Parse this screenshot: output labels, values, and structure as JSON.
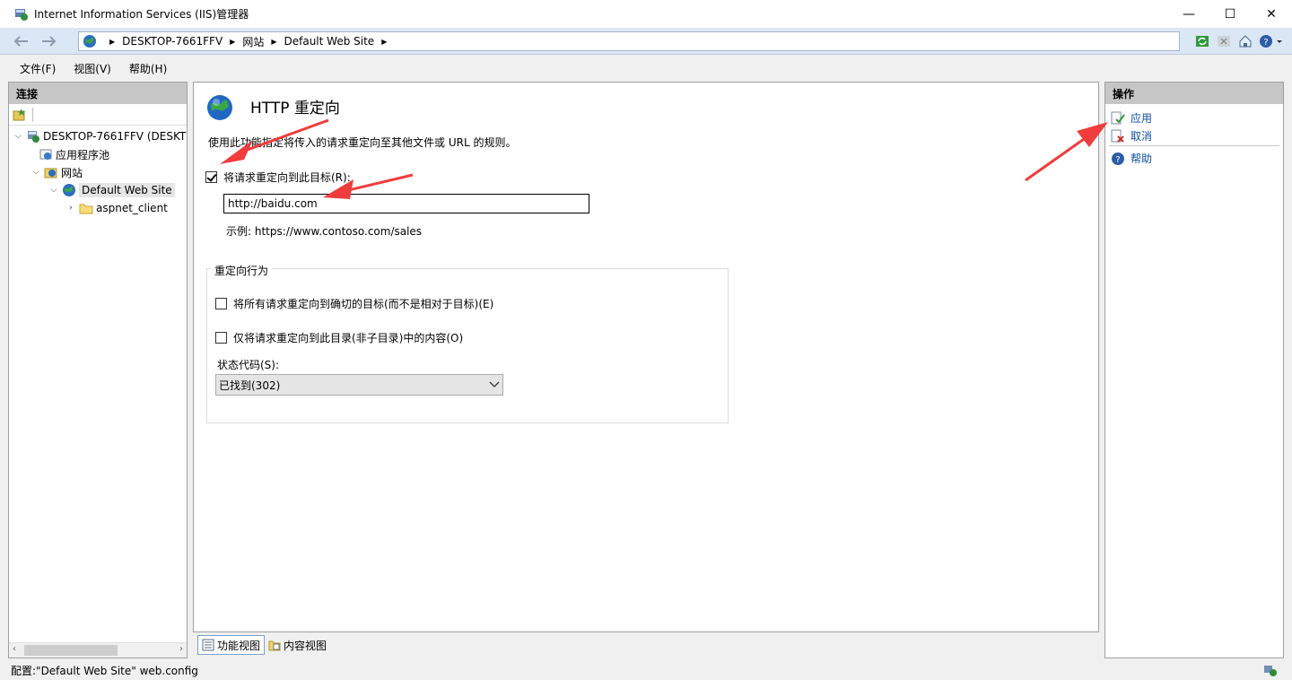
{
  "window": {
    "title": "Internet Information Services (IIS)管理器",
    "minimize": "—",
    "maximize": "☐",
    "close": "✕"
  },
  "address": {
    "crumbs": [
      "DESKTOP-7661FFV",
      "网站",
      "Default Web Site"
    ]
  },
  "menu": [
    "文件(F)",
    "视图(V)",
    "帮助(H)"
  ],
  "connections": {
    "header": "连接",
    "tree": [
      {
        "label": "DESKTOP-7661FFV (DESKT",
        "level": 0,
        "expanded": true
      },
      {
        "label": "应用程序池",
        "level": 1
      },
      {
        "label": "网站",
        "level": 1,
        "expanded": true
      },
      {
        "label": "Default Web Site",
        "level": 2,
        "expanded": true,
        "selected": true
      },
      {
        "label": "aspnet_client",
        "level": 3,
        "expanded": false
      }
    ]
  },
  "feature": {
    "title": "HTTP 重定向",
    "description": "使用此功能指定将传入的请求重定向至其他文件或 URL 的规则。",
    "redirect_checkbox_label": "将请求重定向到此目标(R):",
    "redirect_checked": true,
    "url_value": "http://baidu.com",
    "example": "示例: https://www.contoso.com/sales",
    "behavior_group": "重定向行为",
    "exact_dest_label": "将所有请求重定向到确切的目标(而不是相对于目标)(E)",
    "exact_dest_checked": false,
    "only_dir_label": "仅将请求重定向到此目录(非子目录)中的内容(O)",
    "only_dir_checked": false,
    "status_code_label": "状态代码(S):",
    "status_code_value": "已找到(302)"
  },
  "view_tabs": [
    "功能视图",
    "内容视图"
  ],
  "actions": {
    "header": "操作",
    "apply": "应用",
    "cancel": "取消",
    "help": "帮助"
  },
  "statusbar": {
    "text": "配置:\"Default Web Site\" web.config"
  },
  "colors": {
    "panel_header": "#c6c6c6",
    "link": "#0e4fa6",
    "address_bg": "#dce7f5",
    "annotation": "#f03c3c"
  }
}
